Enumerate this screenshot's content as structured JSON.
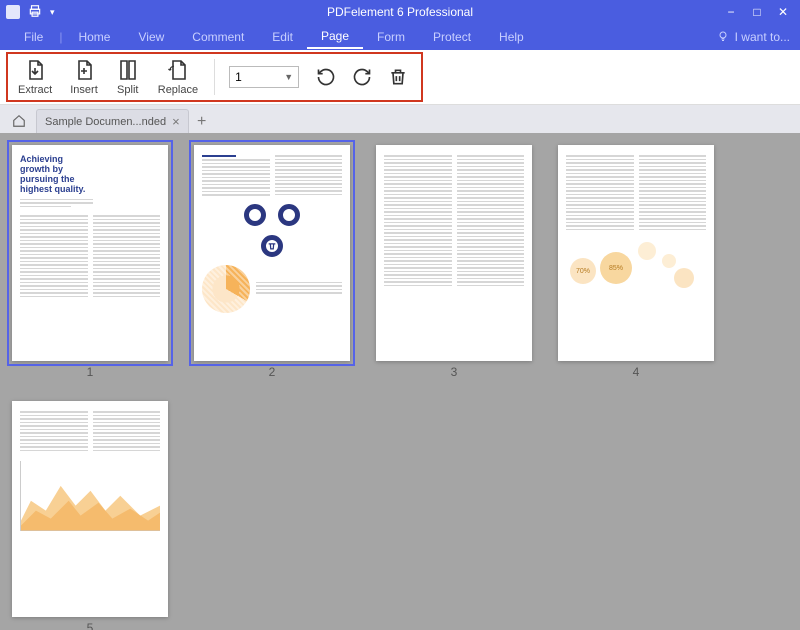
{
  "app": {
    "title": "PDFelement 6 Professional"
  },
  "menubar": {
    "items": [
      "File",
      "Home",
      "View",
      "Comment",
      "Edit",
      "Page",
      "Form",
      "Protect",
      "Help"
    ],
    "active_index": 5,
    "i_want_to": "I want to..."
  },
  "toolbar": {
    "extract": "Extract",
    "insert": "Insert",
    "split": "Split",
    "replace": "Replace",
    "page_field_value": "1",
    "icons": {
      "rotate_ccw": "rotate-ccw",
      "rotate_cw": "rotate-cw",
      "delete": "delete"
    }
  },
  "tabs": {
    "document_name": "Sample Documen...nded",
    "close": "×",
    "add": "+"
  },
  "thumbnails": {
    "count": 5,
    "selected": [
      1,
      2
    ],
    "labels": [
      "1",
      "2",
      "3",
      "4",
      "5"
    ],
    "page1": {
      "heading": "Achieving growth by pursuing the highest quality."
    },
    "page4_bubbles": [
      "70%",
      "85%"
    ]
  },
  "window_controls": {
    "minimize": "−",
    "maximize": "□",
    "close": "✕"
  }
}
